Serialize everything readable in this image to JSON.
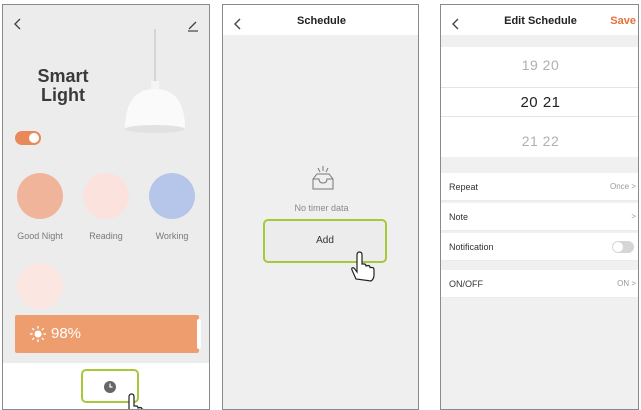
{
  "screen1": {
    "title": "Smart Light",
    "scenes": [
      {
        "label": "Good Night",
        "color": "#f0b49a"
      },
      {
        "label": "Reading",
        "color": "#fbe2dc"
      },
      {
        "label": "Working",
        "color": "#b6c6ea"
      },
      {
        "label": "",
        "color": "#fbe6e2"
      }
    ],
    "brightness": "98%",
    "light_on": true
  },
  "screen2": {
    "title": "Schedule",
    "empty_text": "No timer data",
    "add_label": "Add"
  },
  "screen3": {
    "title": "Edit Schedule",
    "save_label": "Save",
    "picker": {
      "rows": [
        "19  20",
        "20  21",
        "21  22"
      ]
    },
    "rows": [
      {
        "label": "Repeat",
        "value": "Once >"
      },
      {
        "label": "Note",
        "value": ">"
      },
      {
        "label": "Notification",
        "value": ""
      },
      {
        "label": "ON/OFF",
        "value": "ON >"
      }
    ]
  },
  "colors": {
    "accent": "#e3723d",
    "highlight": "#a6c93a",
    "brightness_bar": "#ee9e6e"
  }
}
